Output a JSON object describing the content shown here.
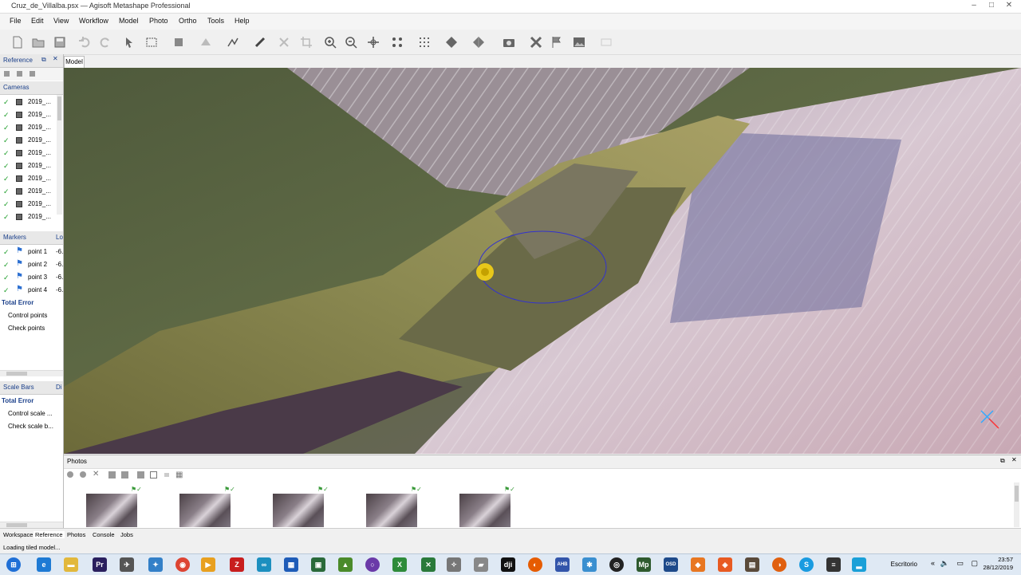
{
  "window": {
    "title": "Cruz_de_Villalba.psx — Agisoft Metashape Professional"
  },
  "menu": [
    "File",
    "Edit",
    "View",
    "Workflow",
    "Model",
    "Photo",
    "Ortho",
    "Tools",
    "Help"
  ],
  "left_panel": {
    "reference_tab": "Reference",
    "cameras_header": "Cameras",
    "cameras": [
      "2019_...",
      "2019_...",
      "2019_...",
      "2019_...",
      "2019_...",
      "2019_...",
      "2019_...",
      "2019_...",
      "2019_...",
      "2019_..."
    ],
    "markers_header": "Markers",
    "markers_col": "Lo",
    "markers": [
      {
        "label": "point 1",
        "value": "-6."
      },
      {
        "label": "point 2",
        "value": "-6."
      },
      {
        "label": "point 3",
        "value": "-6."
      },
      {
        "label": "point 4",
        "value": "-6."
      }
    ],
    "marker_total_error": "Total Error",
    "control_points": "Control points",
    "check_points": "Check points",
    "scale_bars_header": "Scale Bars",
    "scale_bars_col": "Di",
    "scale_total_error": "Total Error",
    "control_scale": "Control scale ...",
    "check_scale": "Check scale b..."
  },
  "viewport": {
    "tab": "Model"
  },
  "photos_pane": {
    "title": "Photos",
    "thumbnail_count": 5
  },
  "bottom_tabs": [
    "Workspace",
    "Reference",
    "Photos",
    "Console",
    "Jobs"
  ],
  "status": "Loading tiled model...",
  "taskbar": {
    "desktop_label": "Escritorio",
    "time": "23:57",
    "date": "28/12/2019"
  },
  "colors": {
    "accent_blue": "#1a3f8a",
    "check_green": "#1e9d2a",
    "marker_blue": "#2c6fd1"
  }
}
